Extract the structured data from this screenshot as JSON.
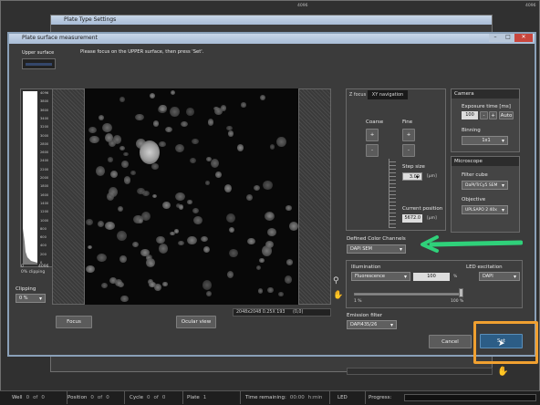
{
  "bg_window": {
    "title": "Plate Type Settings"
  },
  "dialog": {
    "title": "Plate surface measurement",
    "instruction": "Please focus on the UPPER surface, then press 'Set'.",
    "upper_surface_label": "Upper surface"
  },
  "histogram": {
    "ticks": [
      "4096",
      "3800",
      "3600",
      "3400",
      "3200",
      "3000",
      "2800",
      "2600",
      "2400",
      "2200",
      "2000",
      "1800",
      "1600",
      "1400",
      "1200",
      "1000",
      "800",
      "600",
      "400",
      "200",
      "0"
    ],
    "x_min": "0",
    "x_max": "4096",
    "clipping_pct": "0% clipping",
    "clipping_label": "Clipping",
    "clipping_value": "0 %"
  },
  "image": {
    "info": "2048x2048 0.25X 193",
    "coords": "(0,0)"
  },
  "buttons": {
    "focus": "Focus",
    "ocular": "Ocular view",
    "cancel": "Cancel",
    "set": "Set",
    "plus": "+",
    "minus": "-",
    "auto": "Auto"
  },
  "zfocus": {
    "tab_z": "Z focus",
    "tab_xy": "XY navigation",
    "coarse": "Coarse",
    "fine": "Fine",
    "step_label": "Step size",
    "step_value": "3.00",
    "unit": "[μm]",
    "pos_label": "Current position",
    "pos_value": "5672.0"
  },
  "camera": {
    "header": "Camera",
    "exposure_label": "Exposure time [ms]",
    "exposure_value": "100",
    "binning_label": "Binning",
    "binning_value": "1x1"
  },
  "microscope": {
    "header": "Microscope",
    "filter_label": "Filter cube",
    "filter_value": "DaPI/TrCy5 SEM",
    "objective_label": "Objective",
    "objective_value": "UPLSAPO 2 40x"
  },
  "channels": {
    "label": "Defined Color Channels",
    "value": "DAPI SEM"
  },
  "illumination": {
    "label": "Illumination",
    "value": "Fluorescence",
    "percent": "100",
    "pct_unit": "%",
    "slider_min": "1 %",
    "slider_max": "100 %",
    "level": 1.0,
    "led_label": "LED excitation",
    "led_value": "DAPI"
  },
  "emission": {
    "label": "Emission filter",
    "value": "DAPI435/26"
  },
  "status": {
    "well_label": "Well",
    "well_value": "0",
    "well_of": "of",
    "well_total": "0",
    "pos_label": "Position",
    "pos_value": "0",
    "pos_of": "of",
    "pos_total": "0",
    "cycle_label": "Cycle",
    "cycle_value": "0",
    "cycle_of": "of",
    "cycle_total": "0",
    "plate_label": "Plate",
    "plate_value": "1",
    "time_label": "Time remaining:",
    "time_value": "00:00",
    "time_unit": "h:min",
    "led_label": "LED",
    "progress_label": "Progress:"
  },
  "colors": {
    "arrow": "#2fd17a",
    "highlight": "#f0a030",
    "set_button": "#2c5d86"
  }
}
